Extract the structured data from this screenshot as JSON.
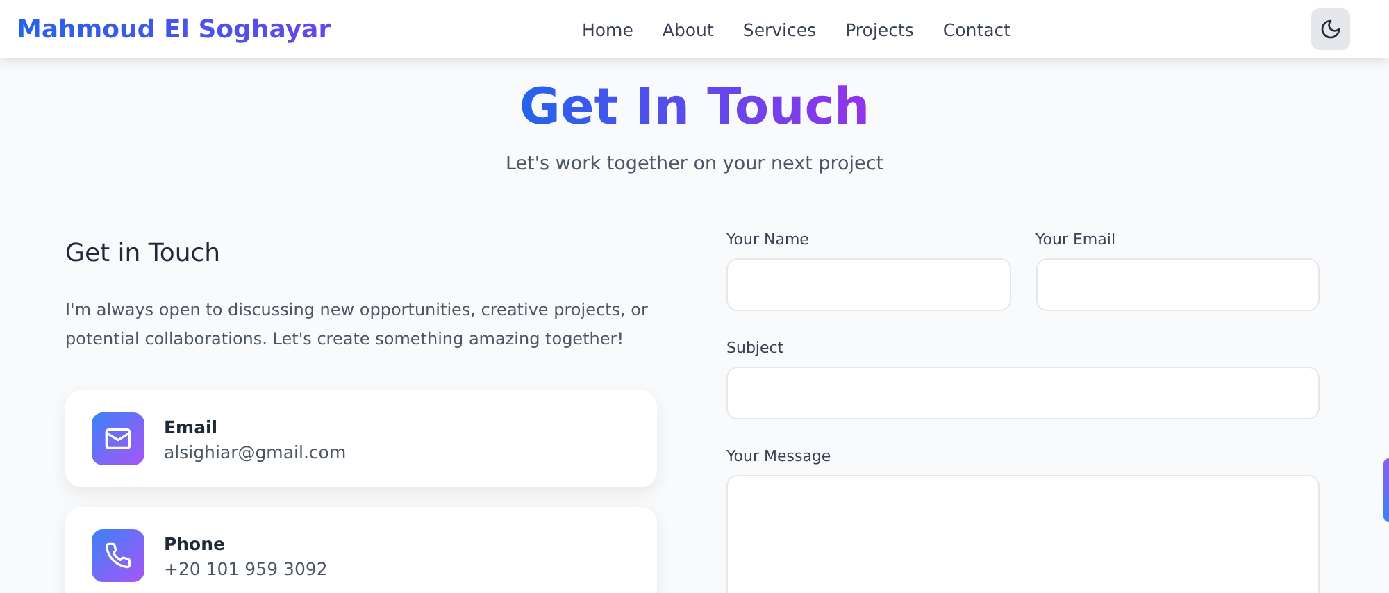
{
  "header": {
    "brand": "Mahmoud El Soghayar",
    "nav": [
      {
        "label": "Home"
      },
      {
        "label": "About"
      },
      {
        "label": "Services"
      },
      {
        "label": "Projects"
      },
      {
        "label": "Contact"
      }
    ]
  },
  "hero": {
    "title": "Get In Touch",
    "subtitle": "Let's work together on your next project"
  },
  "info": {
    "heading": "Get in Touch",
    "text": "I'm always open to discussing new opportunities, creative projects, or potential collaborations. Let's create something amazing together!",
    "cards": [
      {
        "kind": "email",
        "label": "Email",
        "value": "alsighiar@gmail.com"
      },
      {
        "kind": "phone",
        "label": "Phone",
        "value": "+20 101 959 3092"
      }
    ]
  },
  "form": {
    "name_label": "Your Name",
    "email_label": "Your Email",
    "subject_label": "Subject",
    "message_label": "Your Message"
  }
}
